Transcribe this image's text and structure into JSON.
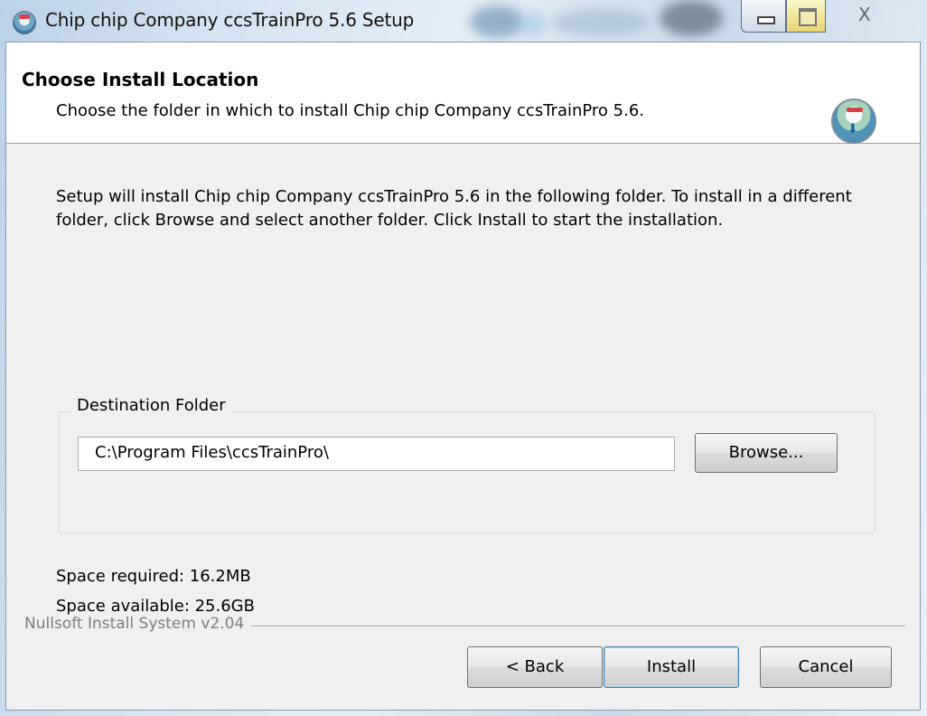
{
  "window": {
    "title": "Chip chip Company ccsTrainPro 5.6 Setup",
    "app_icon": "installer-globe-icon",
    "caption_buttons": {
      "minimize": "minimize-icon",
      "maximize": "maximize-icon",
      "close": "close-icon",
      "close_glyph": "X"
    }
  },
  "header": {
    "title": "Choose Install Location",
    "subtitle": "Choose the folder in which to install Chip chip Company ccsTrainPro 5.6.",
    "icon": "installer-globe-icon"
  },
  "body": {
    "description": "Setup will install Chip chip Company ccsTrainPro 5.6 in the following folder. To install in a different folder, click Browse and select another folder. Click Install to start the installation."
  },
  "destination": {
    "label": "Destination Folder",
    "path": "C:\\Program Files\\ccsTrainPro\\",
    "browse_label": "Browse..."
  },
  "space": {
    "required": "Space required: 16.2MB",
    "available": "Space available: 25.6GB"
  },
  "footer": {
    "branding": "Nullsoft Install System v2.04",
    "back_label": "< Back",
    "install_label": "Install",
    "cancel_label": "Cancel"
  }
}
